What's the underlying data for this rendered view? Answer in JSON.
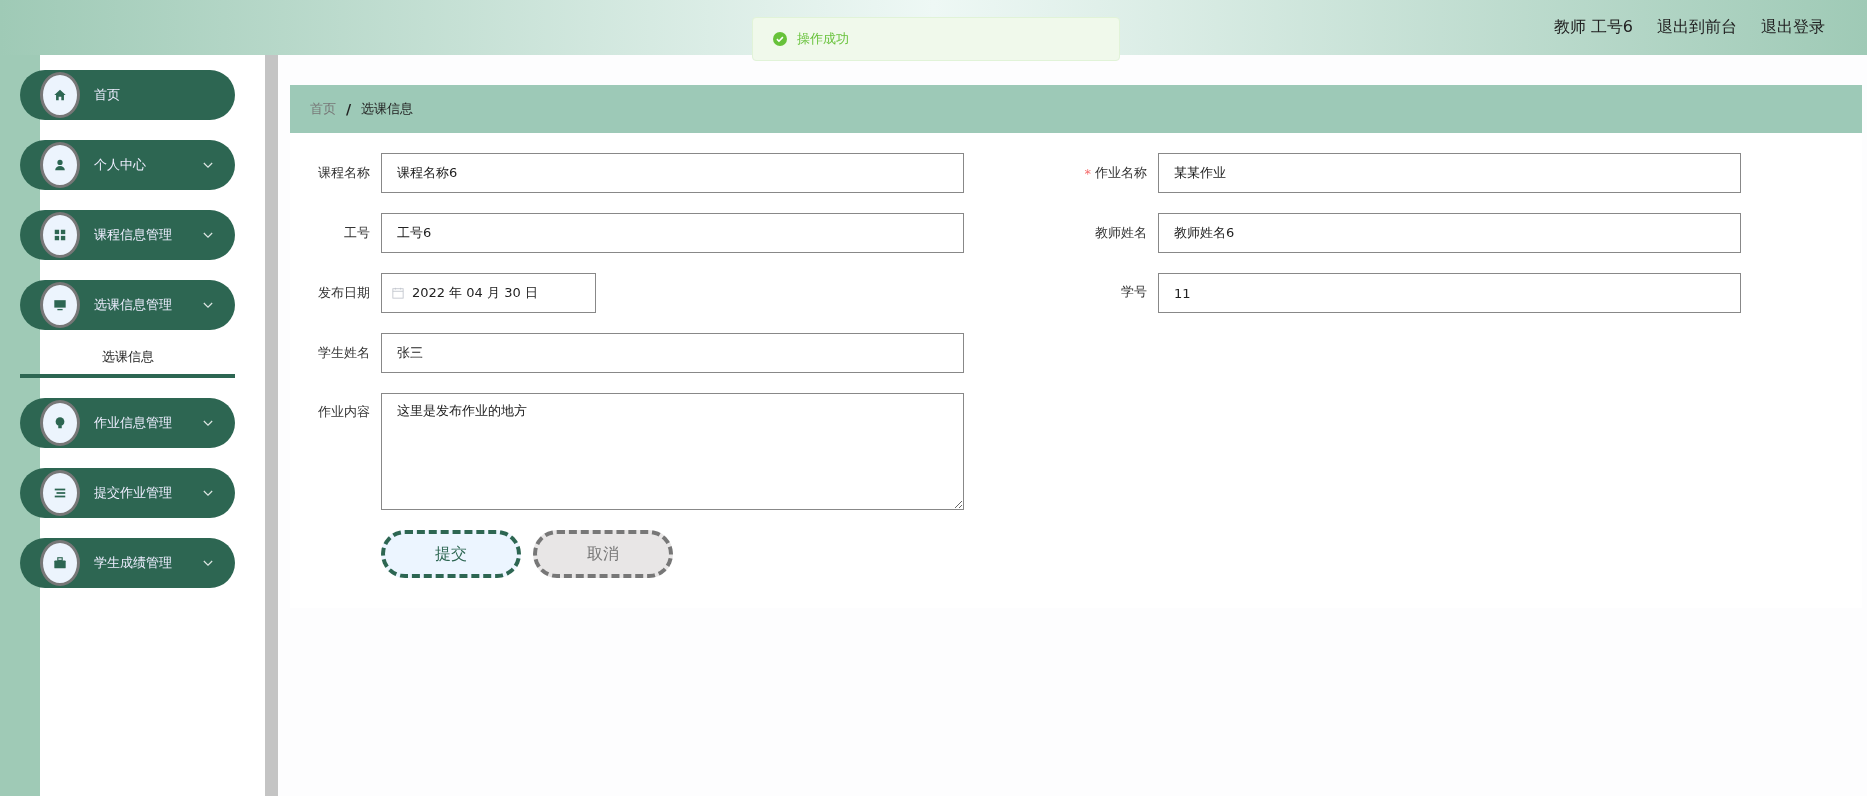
{
  "header": {
    "user": "教师 工号6",
    "links": [
      "退出到前台",
      "退出登录"
    ]
  },
  "toast": {
    "kind": "success",
    "text": "操作成功"
  },
  "sidebar": {
    "items": [
      {
        "label": "首页",
        "has_submenu": false
      },
      {
        "label": "个人中心",
        "has_submenu": true
      },
      {
        "label": "课程信息管理",
        "has_submenu": true
      },
      {
        "label": "选课信息管理",
        "has_submenu": true,
        "children": [
          {
            "label": "选课信息",
            "selected": true
          }
        ]
      },
      {
        "label": "作业信息管理",
        "has_submenu": true
      },
      {
        "label": "提交作业管理",
        "has_submenu": true
      },
      {
        "label": "学生成绩管理",
        "has_submenu": true
      }
    ]
  },
  "breadcrumb_separator": "/",
  "breadcrumb": [
    {
      "label": "首页",
      "current": false
    },
    {
      "label": "选课信息",
      "current": true
    }
  ],
  "form": {
    "left_fields": [
      {
        "kind": "text",
        "label": "课程名称",
        "value": "课程名称6"
      },
      {
        "kind": "text",
        "label": "工号",
        "value": "工号6"
      },
      {
        "kind": "date",
        "label": "发布日期",
        "value": "2022 年 04 月 30 日"
      },
      {
        "kind": "text",
        "label": "学生姓名",
        "value": "张三"
      },
      {
        "kind": "textarea",
        "label": "作业内容",
        "value": "这里是发布作业的地方"
      }
    ],
    "right_fields": [
      {
        "kind": "text",
        "label": "作业名称",
        "value": "某某作业",
        "required_mark": "*"
      },
      {
        "kind": "text",
        "label": "教师姓名",
        "value": "教师姓名6"
      },
      {
        "kind": "text",
        "label": "学号",
        "value": "11"
      }
    ],
    "buttons": [
      {
        "kind": "primary",
        "label": "提交"
      },
      {
        "kind": "secondary",
        "label": "取消"
      }
    ]
  }
}
